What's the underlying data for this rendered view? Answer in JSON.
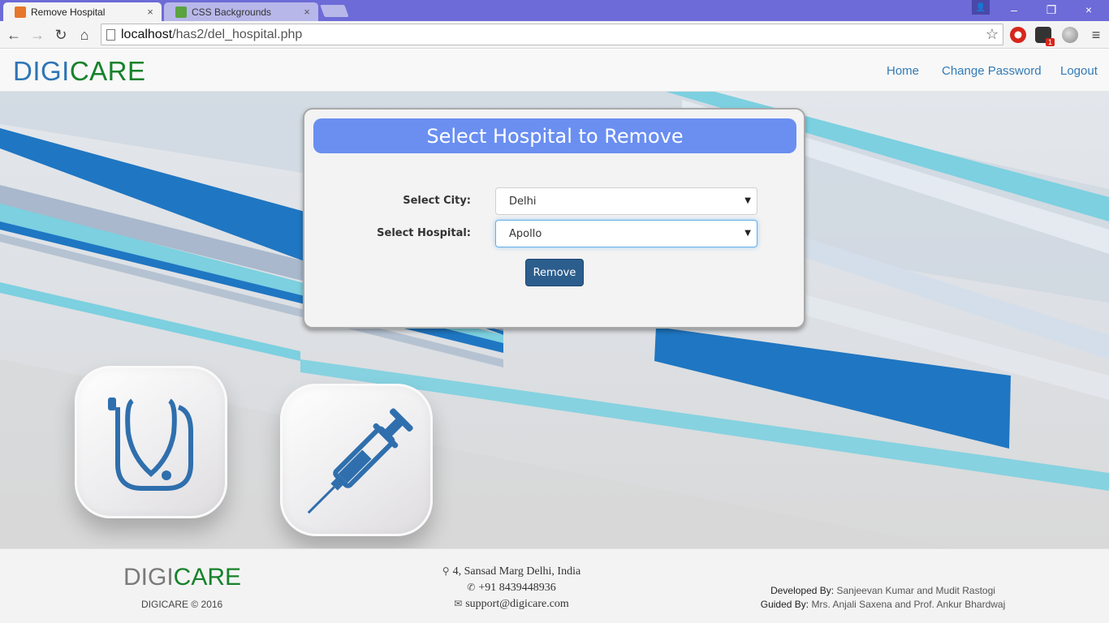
{
  "browser": {
    "tabs": [
      {
        "title": "Remove Hospital",
        "favicon_color": "#e8762b",
        "active": true
      },
      {
        "title": "CSS Backgrounds",
        "favicon_color": "#5aa33f",
        "active": false
      }
    ],
    "address": {
      "host": "localhost",
      "path": "/has2/del_hospital.php"
    },
    "icons": {
      "back": "←",
      "forward": "→",
      "reload": "↻",
      "home": "⌂",
      "star": "☆",
      "menu": "≡",
      "close": "×",
      "minimize": "–",
      "restore": "❐",
      "profile": "👤"
    },
    "extension_badge": "1"
  },
  "header": {
    "brand_digi": "DIGI",
    "brand_care": "CARE",
    "nav": {
      "home": "Home",
      "change_password": "Change Password",
      "logout": "Logout"
    }
  },
  "form": {
    "title": "Select Hospital to Remove",
    "city_label": "Select City:",
    "city_value": "Delhi",
    "hospital_label": "Select Hospital:",
    "hospital_value": "Apollo",
    "caret": "▼",
    "submit_label": "Remove"
  },
  "footer": {
    "brand_digi": "DIGI",
    "brand_care": "CARE",
    "copyright": "DIGICARE © 2016",
    "address": "4, Sansad Marg Delhi, India",
    "phone": "+91 8439448936",
    "email": "support@digicare.com",
    "icons": {
      "map": "⚲",
      "phone": "✆",
      "mail": "✉"
    },
    "developed_by_label": "Developed By:",
    "developed_by": "Sanjeevan Kumar and Mudit Rastogi",
    "guided_by_label": "Guided By:",
    "guided_by": "Mrs. Anjali Saxena and Prof. Ankur Bhardwaj"
  },
  "colors": {
    "accent_blue": "#2f75b5",
    "brand_green": "#16822b",
    "panel_header": "#6a8ff1",
    "button": "#2c5e8d"
  }
}
